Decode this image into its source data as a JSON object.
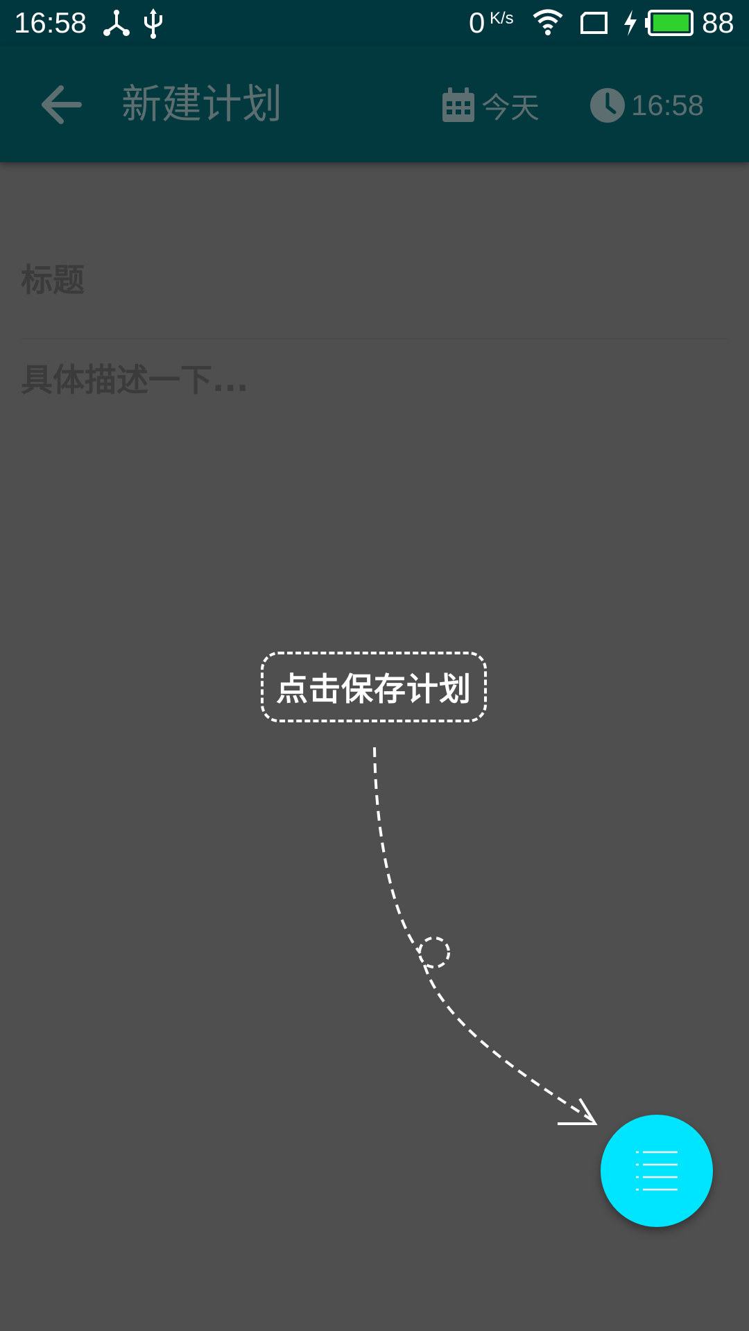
{
  "status_bar": {
    "time": "16:58",
    "net_speed": "0",
    "net_unit": "K/s",
    "battery_level": "88",
    "icons": [
      "share-icon",
      "usb-icon",
      "wifi-icon",
      "sim-icon",
      "charging-icon",
      "battery-icon"
    ],
    "battery_color": "#2fd12f"
  },
  "app_bar": {
    "title": "新建计划",
    "date_label": "今天",
    "time_label": "16:58",
    "back_icon": "arrow-left-icon",
    "date_icon": "calendar-icon",
    "time_icon": "clock-icon"
  },
  "form": {
    "title_placeholder": "标题",
    "description_placeholder": "具体描述一下..."
  },
  "guide": {
    "text": "点击保存计划"
  },
  "fab": {
    "icon": "list-icon",
    "color": "#00e5ff"
  },
  "colors": {
    "status_bar": "#00363d",
    "overlay": "#4f4f4f"
  }
}
